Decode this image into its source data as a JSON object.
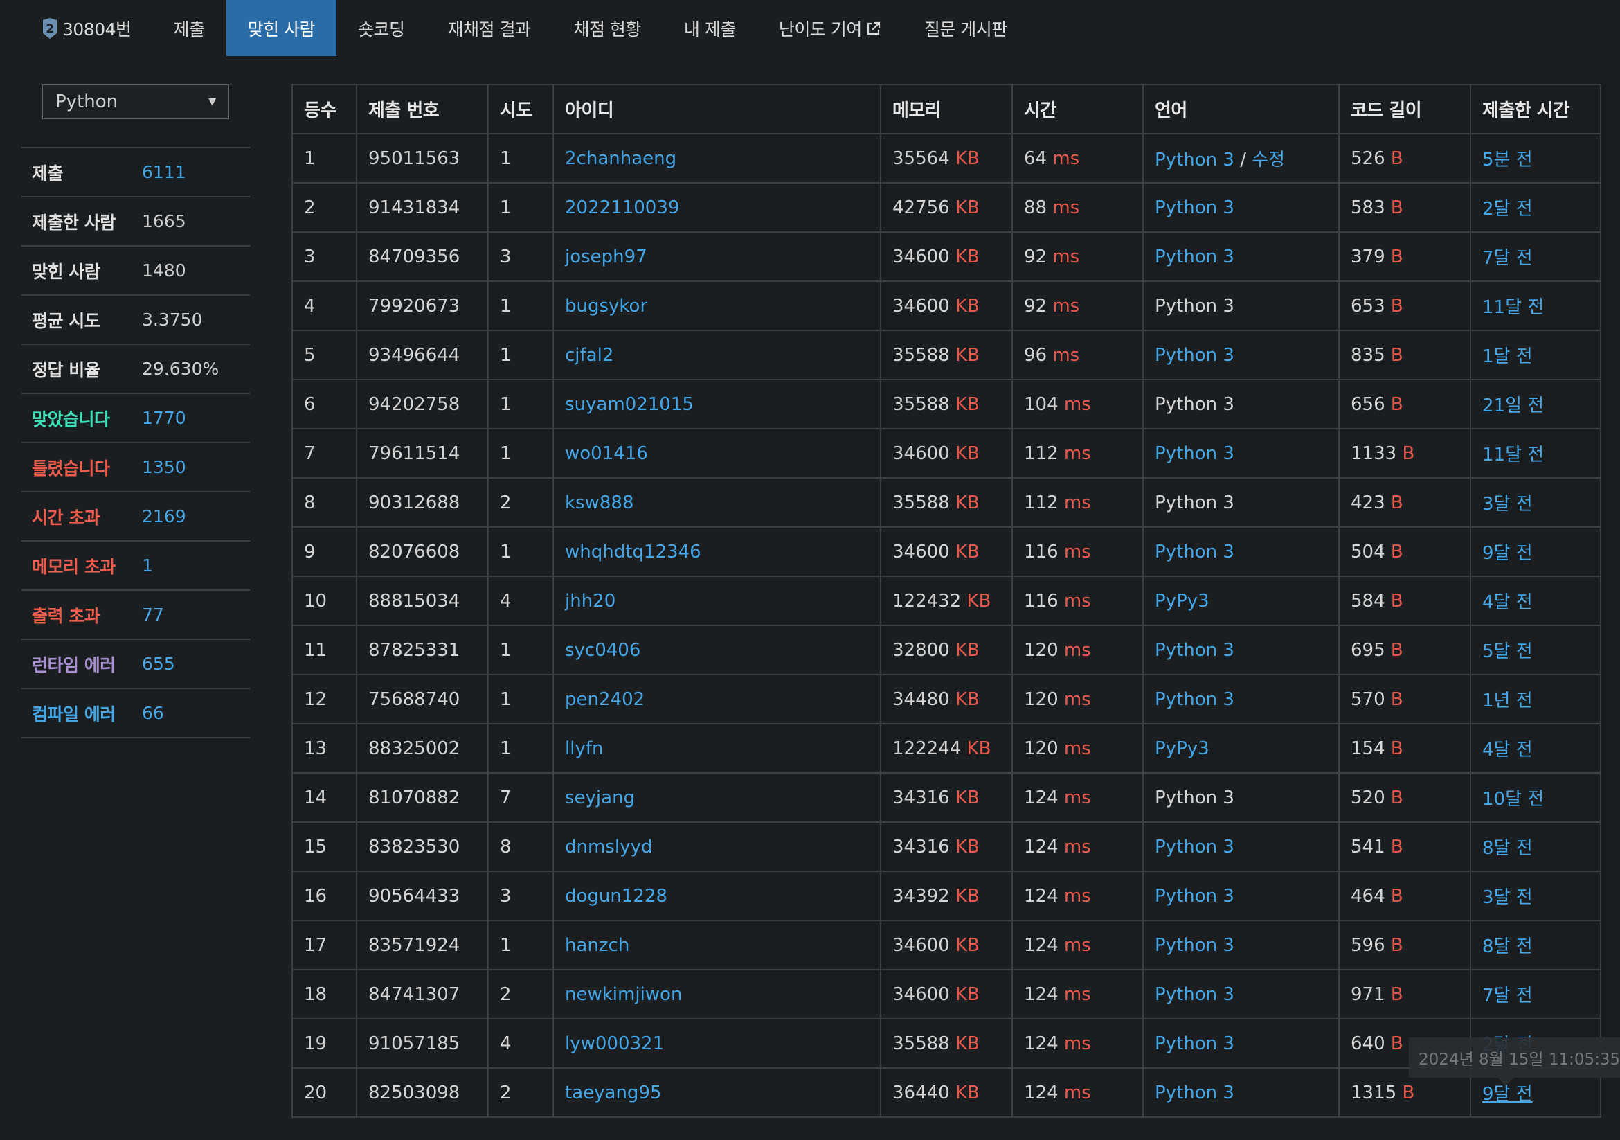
{
  "nav": {
    "problem": "30804번",
    "tier": "2",
    "tabs": [
      "제출",
      "맞힌 사람",
      "숏코딩",
      "재채점 결과",
      "채점 현황",
      "내 제출",
      "난이도 기여",
      "질문 게시판"
    ],
    "active": "맞힌 사람"
  },
  "sidebar": {
    "language": "Python",
    "stats": [
      {
        "label": "제출",
        "value": "6111",
        "label_color": "#e0e0e0",
        "link": true
      },
      {
        "label": "제출한 사람",
        "value": "1665",
        "label_color": "#e0e0e0",
        "link": false
      },
      {
        "label": "맞힌 사람",
        "value": "1480",
        "label_color": "#e0e0e0",
        "link": false
      },
      {
        "label": "평균 시도",
        "value": "3.3750",
        "label_color": "#e0e0e0",
        "link": false
      },
      {
        "label": "정답 비율",
        "value": "29.630%",
        "label_color": "#e0e0e0",
        "link": false
      },
      {
        "label": "맞았습니다",
        "value": "1770",
        "label_color": "#3de0b8",
        "link": true
      },
      {
        "label": "틀렸습니다",
        "value": "1350",
        "label_color": "#ef5b4c",
        "link": true
      },
      {
        "label": "시간 초과",
        "value": "2169",
        "label_color": "#ef5b4c",
        "link": true
      },
      {
        "label": "메모리 초과",
        "value": "1",
        "label_color": "#ef5b4c",
        "link": true
      },
      {
        "label": "출력 초과",
        "value": "77",
        "label_color": "#ef5b4c",
        "link": true
      },
      {
        "label": "런타임 에러",
        "value": "655",
        "label_color": "#a78fd1",
        "link": true
      },
      {
        "label": "컴파일 에러",
        "value": "66",
        "label_color": "#44a6e6",
        "link": true
      }
    ]
  },
  "table": {
    "columns": [
      "등수",
      "제출 번호",
      "시도",
      "아이디",
      "메모리",
      "시간",
      "언어",
      "코드 길이",
      "제출한 시간"
    ],
    "units": {
      "memory": "KB",
      "time": "ms",
      "code": "B"
    },
    "edit_label": "수정",
    "rows": [
      {
        "rank": "1",
        "id": "95011563",
        "tries": "1",
        "user": "2chanhaeng",
        "memory": "35564",
        "time": "64",
        "lang": "Python 3",
        "lang_link": true,
        "edit": true,
        "code": "526",
        "when": "5분 전"
      },
      {
        "rank": "2",
        "id": "91431834",
        "tries": "1",
        "user": "2022110039",
        "memory": "42756",
        "time": "88",
        "lang": "Python 3",
        "lang_link": true,
        "edit": false,
        "code": "583",
        "when": "2달 전"
      },
      {
        "rank": "3",
        "id": "84709356",
        "tries": "3",
        "user": "joseph97",
        "memory": "34600",
        "time": "92",
        "lang": "Python 3",
        "lang_link": true,
        "edit": false,
        "code": "379",
        "when": "7달 전"
      },
      {
        "rank": "4",
        "id": "79920673",
        "tries": "1",
        "user": "bugsykor",
        "memory": "34600",
        "time": "92",
        "lang": "Python 3",
        "lang_link": false,
        "edit": false,
        "code": "653",
        "when": "11달 전"
      },
      {
        "rank": "5",
        "id": "93496644",
        "tries": "1",
        "user": "cjfal2",
        "memory": "35588",
        "time": "96",
        "lang": "Python 3",
        "lang_link": true,
        "edit": false,
        "code": "835",
        "when": "1달 전"
      },
      {
        "rank": "6",
        "id": "94202758",
        "tries": "1",
        "user": "suyam021015",
        "memory": "35588",
        "time": "104",
        "lang": "Python 3",
        "lang_link": false,
        "edit": false,
        "code": "656",
        "when": "21일 전"
      },
      {
        "rank": "7",
        "id": "79611514",
        "tries": "1",
        "user": "wo01416",
        "memory": "34600",
        "time": "112",
        "lang": "Python 3",
        "lang_link": true,
        "edit": false,
        "code": "1133",
        "when": "11달 전"
      },
      {
        "rank": "8",
        "id": "90312688",
        "tries": "2",
        "user": "ksw888",
        "memory": "35588",
        "time": "112",
        "lang": "Python 3",
        "lang_link": false,
        "edit": false,
        "code": "423",
        "when": "3달 전"
      },
      {
        "rank": "9",
        "id": "82076608",
        "tries": "1",
        "user": "whqhdtq12346",
        "memory": "34600",
        "time": "116",
        "lang": "Python 3",
        "lang_link": true,
        "edit": false,
        "code": "504",
        "when": "9달 전"
      },
      {
        "rank": "10",
        "id": "88815034",
        "tries": "4",
        "user": "jhh20",
        "memory": "122432",
        "time": "116",
        "lang": "PyPy3",
        "lang_link": true,
        "edit": false,
        "code": "584",
        "when": "4달 전"
      },
      {
        "rank": "11",
        "id": "87825331",
        "tries": "1",
        "user": "syc0406",
        "memory": "32800",
        "time": "120",
        "lang": "Python 3",
        "lang_link": true,
        "edit": false,
        "code": "695",
        "when": "5달 전"
      },
      {
        "rank": "12",
        "id": "75688740",
        "tries": "1",
        "user": "pen2402",
        "memory": "34480",
        "time": "120",
        "lang": "Python 3",
        "lang_link": true,
        "edit": false,
        "code": "570",
        "when": "1년 전"
      },
      {
        "rank": "13",
        "id": "88325002",
        "tries": "1",
        "user": "llyfn",
        "memory": "122244",
        "time": "120",
        "lang": "PyPy3",
        "lang_link": true,
        "edit": false,
        "code": "154",
        "when": "4달 전"
      },
      {
        "rank": "14",
        "id": "81070882",
        "tries": "7",
        "user": "seyjang",
        "memory": "34316",
        "time": "124",
        "lang": "Python 3",
        "lang_link": false,
        "edit": false,
        "code": "520",
        "when": "10달 전"
      },
      {
        "rank": "15",
        "id": "83823530",
        "tries": "8",
        "user": "dnmslyyd",
        "memory": "34316",
        "time": "124",
        "lang": "Python 3",
        "lang_link": true,
        "edit": false,
        "code": "541",
        "when": "8달 전"
      },
      {
        "rank": "16",
        "id": "90564433",
        "tries": "3",
        "user": "dogun1228",
        "memory": "34392",
        "time": "124",
        "lang": "Python 3",
        "lang_link": true,
        "edit": false,
        "code": "464",
        "when": "3달 전"
      },
      {
        "rank": "17",
        "id": "83571924",
        "tries": "1",
        "user": "hanzch",
        "memory": "34600",
        "time": "124",
        "lang": "Python 3",
        "lang_link": true,
        "edit": false,
        "code": "596",
        "when": "8달 전"
      },
      {
        "rank": "18",
        "id": "84741307",
        "tries": "2",
        "user": "newkimjiwon",
        "memory": "34600",
        "time": "124",
        "lang": "Python 3",
        "lang_link": true,
        "edit": false,
        "code": "971",
        "when": "7달 전"
      },
      {
        "rank": "19",
        "id": "91057185",
        "tries": "4",
        "user": "lyw000321",
        "memory": "35588",
        "time": "124",
        "lang": "Python 3",
        "lang_link": true,
        "edit": false,
        "code": "640",
        "when": "2달 전"
      },
      {
        "rank": "20",
        "id": "82503098",
        "tries": "2",
        "user": "taeyang95",
        "memory": "36440",
        "time": "124",
        "lang": "Python 3",
        "lang_link": true,
        "edit": false,
        "code": "1315",
        "when": "9달 전"
      }
    ]
  },
  "tooltip": "2024년 8월 15일 11:05:35",
  "colors": {
    "accent": "#2a6ca8",
    "link": "#44a6e6",
    "unit": "#e8574c",
    "background": "#1b1e20"
  }
}
